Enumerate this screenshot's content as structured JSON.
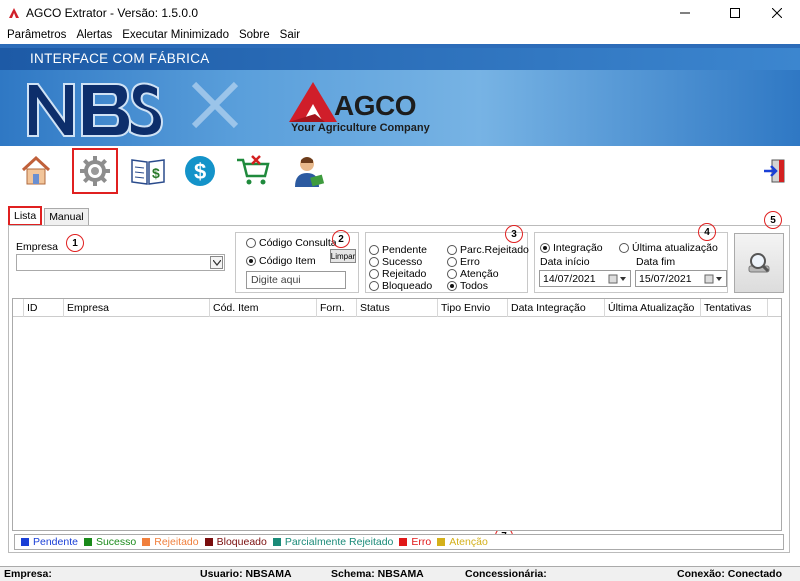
{
  "window": {
    "title": "AGCO Extrator - Versão: 1.5.0.0"
  },
  "menu": [
    "Parâmetros",
    "Alertas",
    "Executar Minimizado",
    "Sobre",
    "Sair"
  ],
  "banner": {
    "title": "INTERFACE COM FÁBRICA",
    "brand": "AGCO",
    "tagline": "Your Agriculture Company"
  },
  "tabs": [
    "Lista",
    "Manual"
  ],
  "filters": {
    "empresa_label": "Empresa",
    "empresa_value": "",
    "codigo_consulta": "Código Consulta",
    "codigo_item": "Código Item",
    "limpar": "Limpar",
    "codigo_placeholder": "Digite aqui",
    "status": {
      "pendente": "Pendente",
      "sucesso": "Sucesso",
      "rejeitado": "Rejeitado",
      "bloqueado": "Bloqueado",
      "parc_rejeitado": "Parc.Rejeitado",
      "erro": "Erro",
      "atencao": "Atenção",
      "todos": "Todos"
    },
    "date_mode": {
      "integracao": "Integração",
      "ultima": "Última atualização"
    },
    "data_inicio_label": "Data início",
    "data_inicio": "14/07/2021",
    "data_fim_label": "Data fim",
    "data_fim": "15/07/2021"
  },
  "markers": [
    "1",
    "2",
    "3",
    "4",
    "5",
    "6",
    "7"
  ],
  "grid": {
    "columns": [
      "ID",
      "Empresa",
      "Cód. Item",
      "Forn.",
      "Status",
      "Tipo Envio",
      "Data Integração",
      "Última Atualização",
      "Tentativas"
    ]
  },
  "legend": [
    {
      "label": "Pendente",
      "color": "#1a3fd6"
    },
    {
      "label": "Sucesso",
      "color": "#1a8a1a"
    },
    {
      "label": "Rejeitado",
      "color": "#f07f3c"
    },
    {
      "label": "Bloqueado",
      "color": "#7a0d0d"
    },
    {
      "label": "Parcialmente Rejeitado",
      "color": "#1a8a78"
    },
    {
      "label": "Erro",
      "color": "#e01818"
    },
    {
      "label": "Atenção",
      "color": "#d4b01a"
    }
  ],
  "status_bar": {
    "empresa": "Empresa:",
    "usuario": "Usuario: NBSAMA",
    "schema": "Schema: NBSAMA",
    "concessionaria": "Concessionária:",
    "conexao": "Conexão: Conectado"
  },
  "colors": {
    "accent_red": "#e02020",
    "banner_blue": "#2c6bb8"
  }
}
